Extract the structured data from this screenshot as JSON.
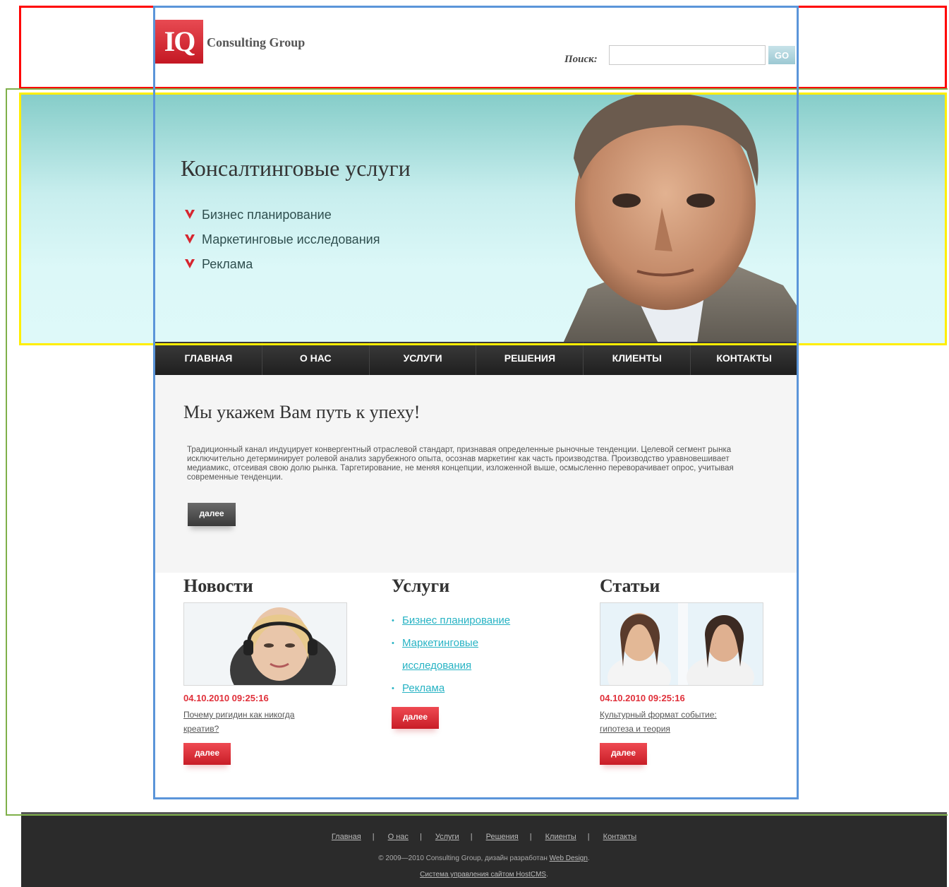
{
  "header": {
    "logo_letters": "IQ",
    "logo_text": "Consulting Group",
    "search_label": "Поиск:",
    "search_value": "",
    "search_button": "GO"
  },
  "banner": {
    "title": "Консалтинговые услуги",
    "items": [
      "Бизнес планирование",
      "Маркетинговые исследования",
      "Реклама"
    ]
  },
  "nav": {
    "items": [
      "ГЛАВНАЯ",
      "О НАС",
      "УСЛУГИ",
      "РЕШЕНИЯ",
      "КЛИЕНТЫ",
      "КОНТАКТЫ"
    ]
  },
  "intro": {
    "title": "Мы укажем Вам путь к упеху!",
    "text": "Традиционный канал индуцирует конвергентный отраслевой стандарт, признавая определенные рыночные тенденции. Целевой сегмент рынка исключительно детерминирует ролевой анализ зарубежного опыта, осознав маркетинг как часть производства. Производство уравновешивает медиамикс, отсеивая свою долю рынка. Таргетирование, не меняя концепции, изложенной выше, осмысленно переворачивает опрос, учитывая современные тенденции.",
    "more": "далее"
  },
  "news": {
    "title": "Новости",
    "date": "04.10.2010 09:25:16",
    "link": "Почему ригидин как никогда креатив?",
    "more": "далее"
  },
  "services": {
    "title": "Услуги",
    "items": [
      "Бизнес планирование",
      "Маркетинговые исследования",
      "Реклама"
    ],
    "more": "далее"
  },
  "articles": {
    "title": "Статьи",
    "date": "04.10.2010 09:25:16",
    "link": "Культурный формат событие: гипотеза и теория",
    "more": "далее"
  },
  "footer": {
    "links": [
      "Главная",
      "О нас",
      "Услуги",
      "Решения",
      "Клиенты",
      "Контакты"
    ],
    "copyright": "© 2009—2010 Consulting Group, дизайн разработан",
    "design_link": "Web Design",
    "cms_text": "Система управления сайтом HostCMS"
  },
  "colors": {
    "brand_red": "#d42a33",
    "accent_teal": "#27b3c4",
    "nav_dark": "#2b2b2b"
  }
}
